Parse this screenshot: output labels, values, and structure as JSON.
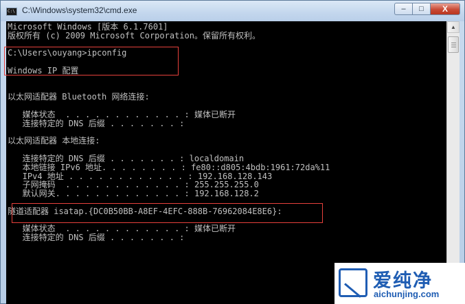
{
  "window": {
    "title": "C:\\Windows\\system32\\cmd.exe",
    "icon_label": "C:\\",
    "controls": {
      "minimize": "–",
      "maximize": "□",
      "close": "X"
    }
  },
  "console": {
    "lines": [
      "Microsoft Windows [版本 6.1.7601]",
      "版权所有 (c) 2009 Microsoft Corporation。保留所有权利。",
      "",
      "C:\\Users\\ouyang>ipconfig",
      "",
      "Windows IP 配置",
      "",
      "",
      "以太网适配器 Bluetooth 网络连接:",
      "",
      "   媒体状态  . . . . . . . . . . . . : 媒体已断开",
      "   连接特定的 DNS 后缀 . . . . . . . :",
      "",
      "以太网适配器 本地连接:",
      "",
      "   连接特定的 DNS 后缀 . . . . . . . : localdomain",
      "   本地链接 IPv6 地址. . . . . . . . : fe80::d805:4bdb:1961:72da%11",
      "   IPv4 地址 . . . . . . . . . . . . : 192.168.128.143",
      "   子网掩码  . . . . . . . . . . . . : 255.255.255.0",
      "   默认网关. . . . . . . . . . . . . : 192.168.128.2",
      "",
      "隧道适配器 isatap.{DC0B50BB-A8EF-4EFC-888B-76962084E8E6}:",
      "",
      "   媒体状态  . . . . . . . . . . . . : 媒体已断开",
      "   连接特定的 DNS 后缀 . . . . . . . :"
    ]
  },
  "scrollbar": {
    "up_arrow": "▲",
    "down_arrow": "▼"
  },
  "watermark": {
    "name": "爱纯净",
    "url": "aichunjing.com"
  },
  "colors": {
    "console_bg": "#000000",
    "console_text": "#c0c0c0",
    "highlight": "#e8413c",
    "brand": "#1f5db3"
  }
}
